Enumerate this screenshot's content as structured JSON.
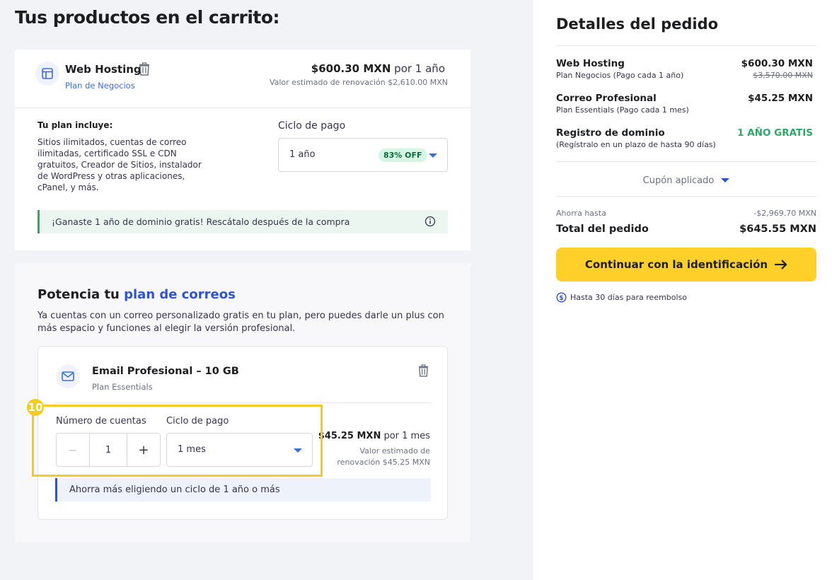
{
  "page_title": "Tus productos en el carrito:",
  "hosting": {
    "name": "Web Hosting",
    "plan": "Plan de Negocios",
    "price": "$600.30 MXN",
    "period": "por 1 año",
    "renewal": "Valor estimado de renovación $2,610.00 MXN",
    "includes_title": "Tu plan incluye:",
    "includes_text": "Sitios ilimitados, cuentas de correo ilimitadas, certificado SSL e CDN gratuitos, Creador de Sitios, instalador de WordPress y otras aplicaciones, cPanel, y más.",
    "cycle_label": "Ciclo de pago",
    "cycle_value": "1 año",
    "discount_badge": "83% OFF",
    "promo_text": "¡Ganaste 1 año de dominio gratis! Rescátalo después de la compra"
  },
  "upsell": {
    "title_prefix": "Potencia tu ",
    "title_highlight": "plan de correos",
    "description": "Ya cuentas con un correo personalizado gratis en tu plan, pero puedes darle un plus con más espacio y funciones al elegir la versión profesional.",
    "product_name": "Email Profesional – 10 GB",
    "product_plan": "Plan Essentials",
    "step_number": "10",
    "accounts_label": "Número de cuentas",
    "accounts_value": "1",
    "minus": "−",
    "plus": "+",
    "cycle_label": "Ciclo de pago",
    "cycle_value": "1 mes",
    "price": "$45.25 MXN",
    "period": "por 1 mes",
    "renewal_line1": "Valor estimado de",
    "renewal_line2": "renovación $45.25 MXN",
    "tip": "Ahorra más eligiendo un ciclo de 1 año o más"
  },
  "summary": {
    "title": "Detalles del pedido",
    "items": [
      {
        "name": "Web Hosting",
        "sub": "Plan Negocios (Pago cada 1 año)",
        "price": "$600.30 MXN",
        "old_price": "$3,570.00 MXN"
      },
      {
        "name": "Correo Profesional",
        "sub": "Plan Essentials (Pago cada 1 mes)",
        "price": "$45.25 MXN"
      },
      {
        "name": "Registro de dominio",
        "sub": "(Regístralo en un plazo de hasta 90 días)",
        "price": "1 AÑO GRATIS"
      }
    ],
    "coupon": "Cupón aplicado",
    "savings_label": "Ahorra hasta",
    "savings_value": "-$2,969.70 MXN",
    "total_label": "Total del pedido",
    "total_value": "$645.55 MXN",
    "cta": "Continuar con la identificación",
    "refund": "Hasta 30 días para reembolso"
  },
  "colors": {
    "accent": "#3a6fd8",
    "cta": "#fed029",
    "green": "#2ea769",
    "highlight": "#f2cd21"
  }
}
